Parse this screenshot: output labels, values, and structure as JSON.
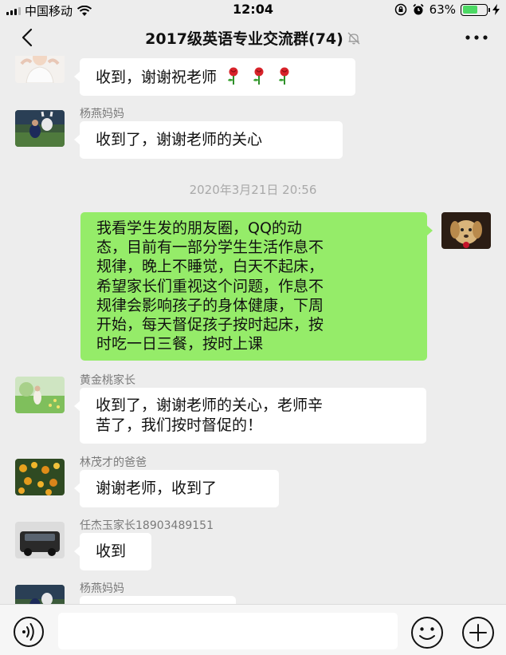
{
  "status_bar": {
    "carrier": "中国移动",
    "time": "12:04",
    "battery_percent": "63%",
    "battery_level": 0.63,
    "icons": [
      "signal-icon",
      "wifi-icon",
      "orientation-lock-icon",
      "alarm-icon",
      "battery-icon",
      "charging-icon"
    ]
  },
  "nav": {
    "title": "2017级英语专业交流群(74)",
    "icons": [
      "back-icon",
      "mute-icon",
      "more-icon"
    ]
  },
  "messages": [
    {
      "type": "incoming",
      "sender": "",
      "text": "收到，谢谢祝老师",
      "decoration": "rose-icon x3"
    },
    {
      "type": "incoming",
      "sender": "杨燕妈妈",
      "text": "收到了，谢谢老师的关心"
    },
    {
      "type": "timestamp",
      "text": "2020年3月21日 20:56"
    },
    {
      "type": "outgoing",
      "lines": [
        "我看学生发的朋友圈，QQ的动",
        "态，目前有一部分学生生活作息不",
        "规律，晚上不睡觉，白天不起床，",
        "希望家长们重视这个问题，作息不",
        "规律会影响孩子的身体健康，下周",
        "开始，每天督促孩子按时起床，按",
        "时吃一日三餐，按时上课"
      ]
    },
    {
      "type": "incoming",
      "sender": "黄金桃家长",
      "lines": [
        "收到了，谢谢老师的关心，老师辛",
        "苦了，我们按时督促的！"
      ]
    },
    {
      "type": "incoming",
      "sender": "林茂才的爸爸",
      "text": "谢谢老师，收到了"
    },
    {
      "type": "incoming",
      "sender": "任杰玉家长18903489151",
      "text": "收到"
    },
    {
      "type": "incoming",
      "sender": "杨燕妈妈",
      "text": ""
    }
  ],
  "input_bar": {
    "icons": [
      "voice-icon",
      "emoji-icon",
      "plus-icon"
    ]
  },
  "colors": {
    "background": "#ededed",
    "outgoing_bubble": "#95ec69",
    "incoming_bubble": "#ffffff",
    "battery_fill": "#4cd964"
  }
}
